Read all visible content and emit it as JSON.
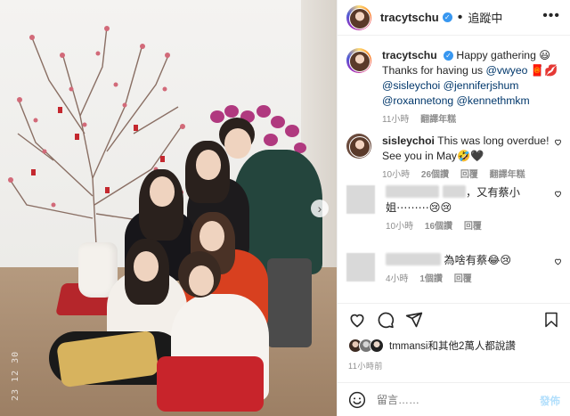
{
  "post": {
    "username": "tracytschu",
    "follow_label": "追蹤中",
    "dot": "•",
    "more_label": "•••",
    "photo_date_stamp": "23 12 30"
  },
  "caption": {
    "username": "tracytschu",
    "line1": "Happy gathering 😃",
    "line2_prefix": "Thanks for having us ",
    "mentions": [
      "@vwyeo",
      "@sisleychoi",
      "@jenniferjshum",
      "@roxannetong",
      "@kennethmkm"
    ],
    "line2_suffix": " 🧧💋",
    "time": "11小時",
    "translate": "翻譯年糕"
  },
  "comments": [
    {
      "username": "sisleychoi",
      "text": "This was long overdue! See you in May🤣🖤",
      "time": "10小時",
      "likes": "26個讚",
      "reply": "回覆",
      "translate": "翻譯年糕"
    },
    {
      "username": "",
      "text": "，又有蔡小姐⋯⋯⋯😢😢",
      "time": "10小時",
      "likes": "16個讚",
      "reply": "回覆"
    },
    {
      "username": "",
      "text": "為啥有蔡😂😢",
      "time": "4小時",
      "likes": "1個讚",
      "reply": "回覆"
    }
  ],
  "likes": {
    "text": "tmmansi和其他2萬人都說讚",
    "time_ago": "11小時前"
  },
  "compose": {
    "placeholder": "留言……",
    "post_label": "發佈"
  },
  "icons": {
    "like": "heart-icon",
    "comment": "comment-icon",
    "share": "paper-plane-icon",
    "save": "bookmark-icon",
    "emoji": "smile-icon",
    "verified": "verified-badge-icon",
    "next": "chevron-right-icon"
  },
  "colors": {
    "link": "#00376b",
    "verified": "#3897f0",
    "muted": "#8e8e8e",
    "post_button": "#b2dffc"
  }
}
